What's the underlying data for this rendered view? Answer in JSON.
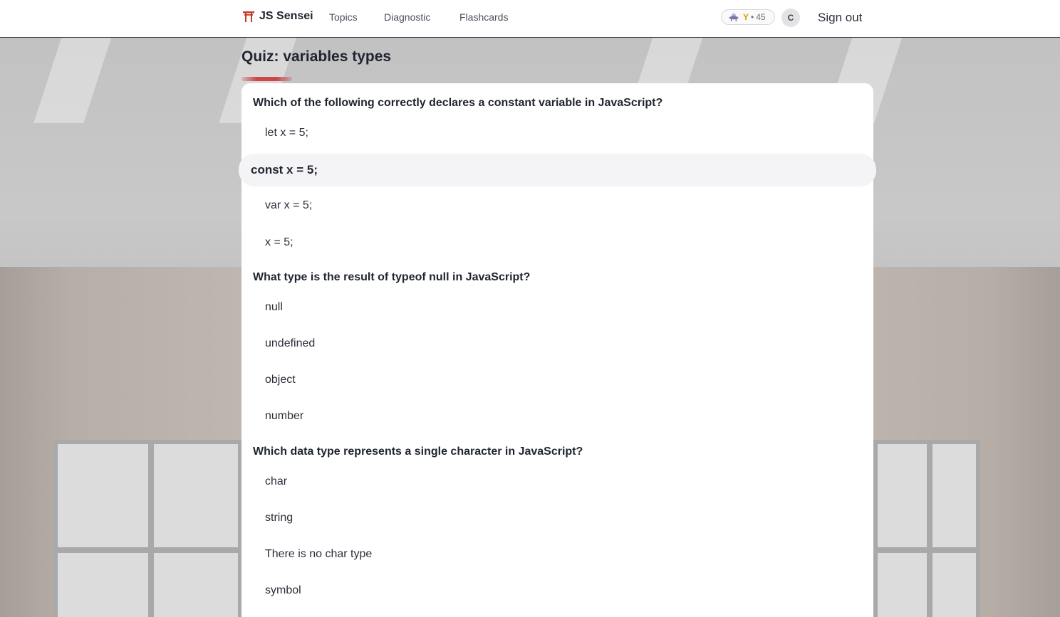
{
  "nav": {
    "brand": "JS Sensei",
    "links": [
      "Topics",
      "Diagnostic",
      "Flashcards"
    ],
    "badge": {
      "rank": "Y",
      "separator": "•",
      "xp": "45",
      "icon": "ufo-icon"
    },
    "avatar_initial": "C",
    "sign_out": "Sign out"
  },
  "page": {
    "title": "Quiz: variables types",
    "progress": 0.08
  },
  "questions": [
    {
      "text": "Which of the following correctly declares a constant variable in JavaScript?",
      "options": [
        "let x = 5;",
        "const x = 5;",
        "var x = 5;",
        "x = 5;"
      ],
      "selected": 1
    },
    {
      "text": "What type is the result of typeof null in JavaScript?",
      "options": [
        "null",
        "undefined",
        "object",
        "number"
      ],
      "selected": null
    },
    {
      "text": "Which data type represents a single character in JavaScript?",
      "options": [
        "char",
        "string",
        "There is no char type",
        "symbol"
      ],
      "selected": null
    }
  ],
  "colors": {
    "accent": "#c94848",
    "rank": "#d1a000",
    "selected_bg": "#f4f4f6"
  }
}
